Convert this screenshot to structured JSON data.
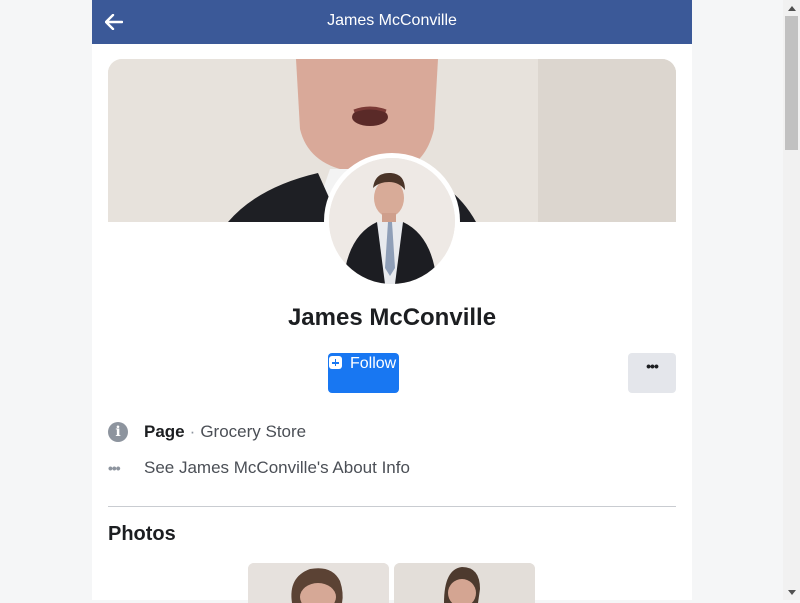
{
  "header": {
    "title": "James McConville"
  },
  "icons": {
    "back": "arrow-left-icon",
    "info": "info-icon",
    "more": "more-dots-icon",
    "follow": "plus-square-icon"
  },
  "profile": {
    "name": "James McConville",
    "follow_label": "Follow",
    "more_label": "•••"
  },
  "info": {
    "info_glyph": "i",
    "page_label": "Page",
    "separator": "·",
    "category": "Grocery Store",
    "dots_glyph": "•••",
    "about_link": "See James McConville's About Info"
  },
  "photos": {
    "title": "Photos"
  },
  "colors": {
    "header": "#3b5998",
    "follow_button": "#1877f2",
    "more_button": "#e4e6eb"
  }
}
